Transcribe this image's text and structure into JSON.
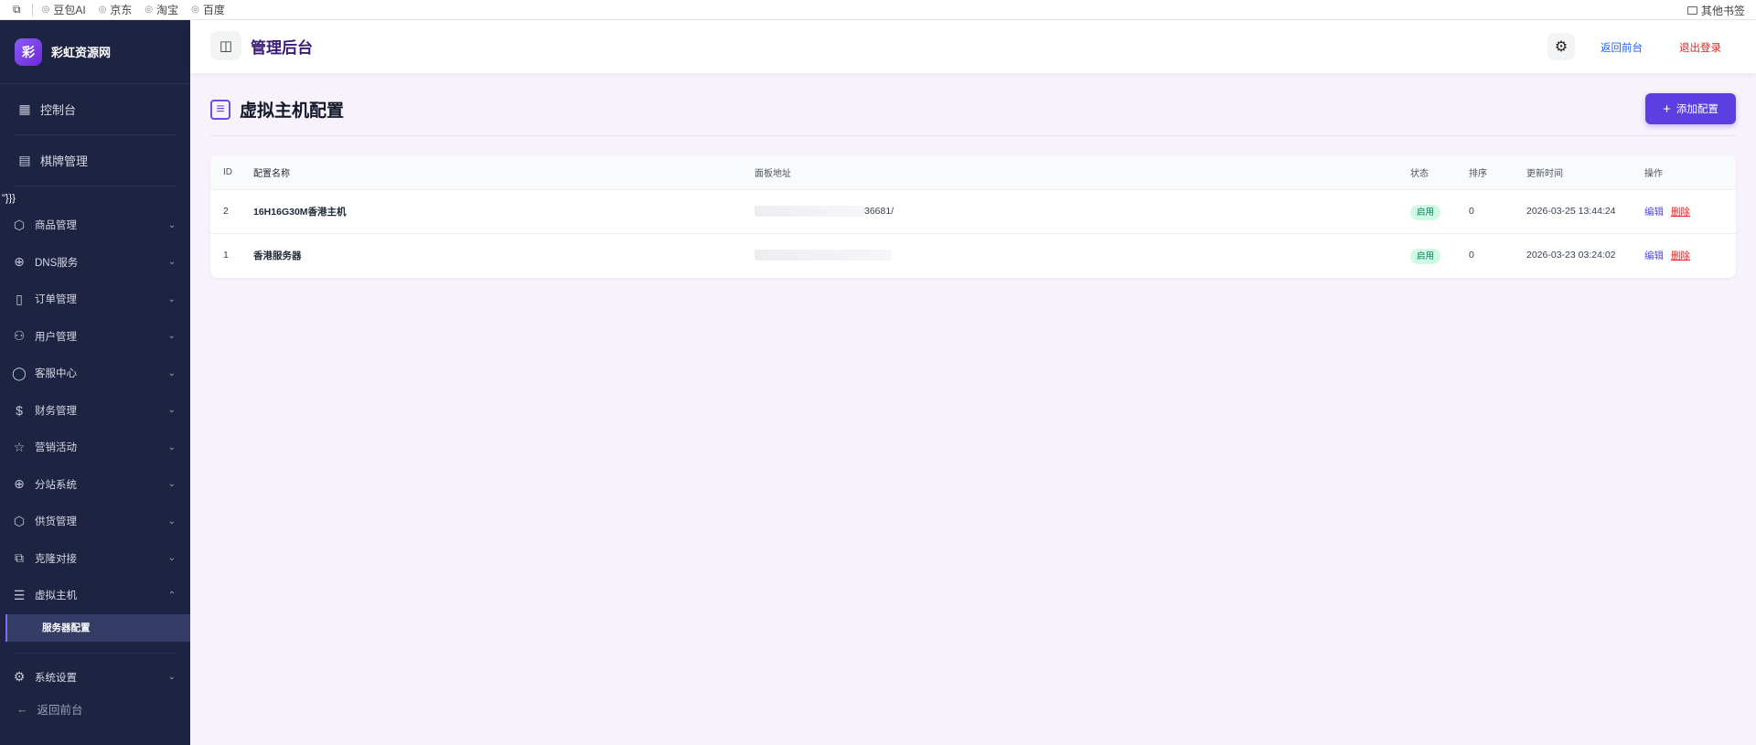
{
  "bookmarks": {
    "items": [
      "豆包AI",
      "京东",
      "淘宝",
      "百度"
    ],
    "other": "其他书签"
  },
  "sidebar": {
    "brand": {
      "logo": "彩",
      "name": "彩虹资源网"
    },
    "top_items": [
      {
        "label": "控制台",
        "icon": "grid-icon"
      },
      {
        "label": "棋牌管理",
        "icon": "layout-icon"
      }
    ],
    "stray_text": "\"}}}",
    "groups": [
      {
        "label": "商品管理",
        "icon": "box-icon"
      },
      {
        "label": "DNS服务",
        "icon": "globe-icon"
      },
      {
        "label": "订单管理",
        "icon": "file-icon"
      },
      {
        "label": "用户管理",
        "icon": "users-icon"
      },
      {
        "label": "客服中心",
        "icon": "chat-icon"
      },
      {
        "label": "财务管理",
        "icon": "dollar-icon"
      },
      {
        "label": "营销活动",
        "icon": "star-icon"
      },
      {
        "label": "分站系统",
        "icon": "globe-icon"
      },
      {
        "label": "供货管理",
        "icon": "box-icon"
      },
      {
        "label": "克隆对接",
        "icon": "copy-icon"
      },
      {
        "label": "虚拟主机",
        "icon": "server-icon"
      }
    ],
    "active_sub": "服务器配置",
    "system": "系统设置",
    "back": "返回前台"
  },
  "header": {
    "title": "管理后台",
    "link_front": "返回前台",
    "link_logout": "退出登录"
  },
  "page": {
    "title": "虚拟主机配置",
    "add_button": "添加配置"
  },
  "table": {
    "columns": [
      "ID",
      "配置名称",
      "面板地址",
      "状态",
      "排序",
      "更新时间",
      "操作"
    ],
    "rows": [
      {
        "id": "2",
        "name": "16H16G30M香港主机",
        "url_visible": "36681/",
        "status": "启用",
        "sort": "0",
        "time": "2026-03-25 13:44:24",
        "edit": "编辑",
        "delete": "删除"
      },
      {
        "id": "1",
        "name": "香港服务器",
        "url_visible": "",
        "status": "启用",
        "sort": "0",
        "time": "2026-03-23 03:24:02",
        "edit": "编辑",
        "delete": "删除"
      }
    ]
  },
  "colors": {
    "sidebar_bg": "#1d2340",
    "accent": "#5b3fe0",
    "page_bg": "#f7f2fc",
    "success": "#047857",
    "danger": "#dc2626"
  }
}
